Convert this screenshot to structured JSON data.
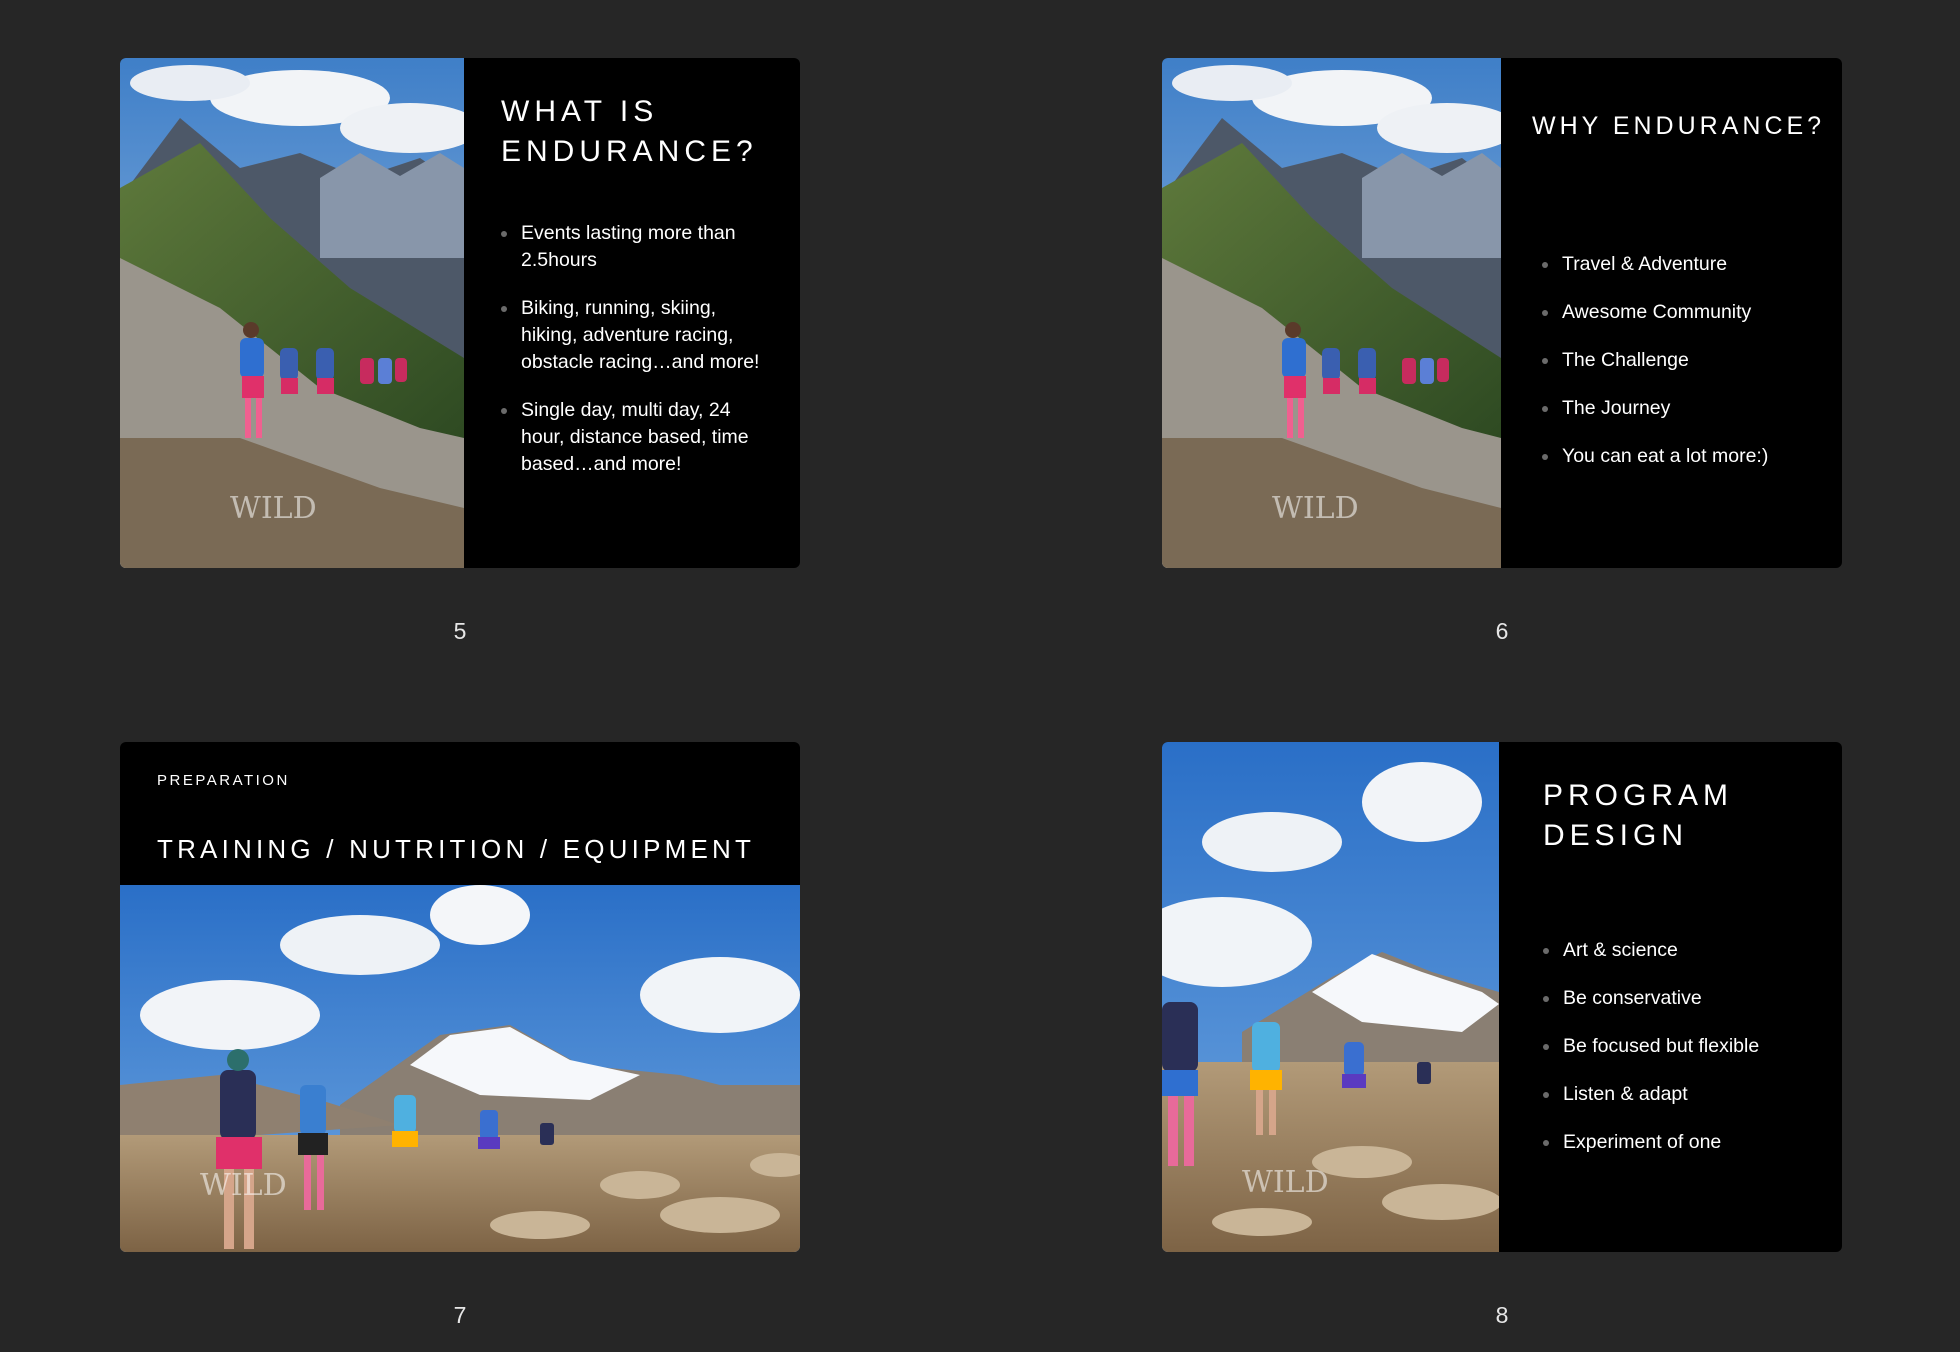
{
  "slides": [
    {
      "number": "5",
      "title": "WHAT IS ENDURANCE?",
      "bullets": [
        "Events lasting more than 2.5hours",
        "Biking, running, skiing, hiking, adventure racing, obstacle racing…and more!",
        "Single day, multi day, 24 hour, distance based, time based…and more!"
      ],
      "photo": "mountain-hikers-photo",
      "watermark": "WILD"
    },
    {
      "number": "6",
      "title": "WHY ENDURANCE?",
      "bullets": [
        "Travel & Adventure",
        "Awesome Community",
        "The Challenge",
        "The Journey",
        "You can eat a lot more:)"
      ],
      "photo": "mountain-hikers-photo",
      "watermark": "WILD"
    },
    {
      "number": "7",
      "kicker": "PREPARATION",
      "title": "TRAINING / NUTRITION / EQUIPMENT",
      "photo": "runners-glacier-photo",
      "watermark": "WILD"
    },
    {
      "number": "8",
      "title": "PROGRAM DESIGN",
      "bullets": [
        "Art & science",
        "Be conservative",
        "Be focused but flexible",
        "Listen & adapt",
        "Experiment of one"
      ],
      "photo": "runners-glacier-photo",
      "watermark": "WILD"
    }
  ],
  "colors": {
    "background": "#262626",
    "slide": "#000000",
    "bullet_dot": "#6b6b6b",
    "text": "#ffffff"
  }
}
